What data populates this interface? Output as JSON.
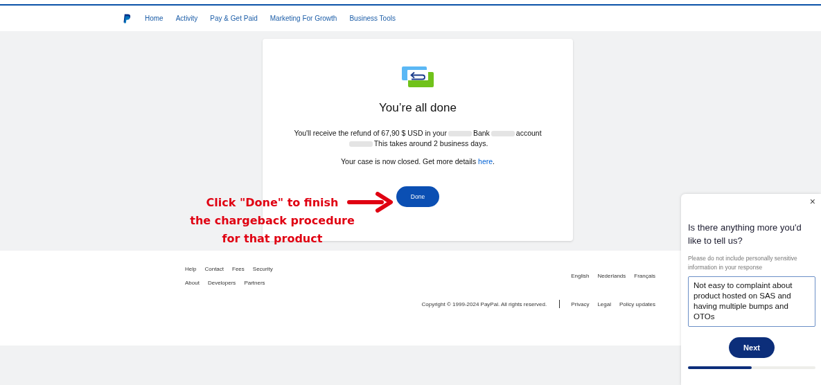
{
  "nav": {
    "items": [
      {
        "label": "Home"
      },
      {
        "label": "Activity"
      },
      {
        "label": "Pay & Get Paid"
      },
      {
        "label": "Marketing For Growth"
      },
      {
        "label": "Business Tools"
      }
    ]
  },
  "card": {
    "title": "You’re all done",
    "message": [
      {
        "kind": "text",
        "text": "You'll receive the refund of 67,90 $ USD in your"
      },
      {
        "kind": "redacted"
      },
      {
        "kind": "text",
        "text": "Bank"
      },
      {
        "kind": "redacted"
      },
      {
        "kind": "text",
        "text": "account"
      },
      {
        "kind": "break"
      },
      {
        "kind": "redacted"
      },
      {
        "kind": "text",
        "text": "This takes around 2 business days."
      }
    ],
    "closed_text": "Your case is now closed. Get more details",
    "closed_link": "here",
    "closed_end": ".",
    "button": "Done"
  },
  "annotation": {
    "lines": [
      "Click \"Done\" to finish",
      "the chargeback procedure",
      "for that product"
    ]
  },
  "footer": {
    "links_row_1": [
      "Help",
      "Contact",
      "Fees",
      "Security"
    ],
    "links_row_2": [
      "About",
      "Developers",
      "Partners"
    ],
    "languages": [
      "English",
      "Nederlands",
      "Français"
    ],
    "copyright": "Copyright © 1999-2024 PayPal. All rights reserved.",
    "legal_links": [
      "Privacy",
      "Legal",
      "Policy updates"
    ]
  },
  "survey": {
    "close": "×",
    "question": "Is there anything more you'd like to tell us?",
    "hint": "Please do not include personally sensitive information in your response",
    "answer": "Not easy to complaint about product hosted on SAS and having multiple bumps and OTOs",
    "button": "Next",
    "progress": {
      "level": 0.5
    }
  }
}
